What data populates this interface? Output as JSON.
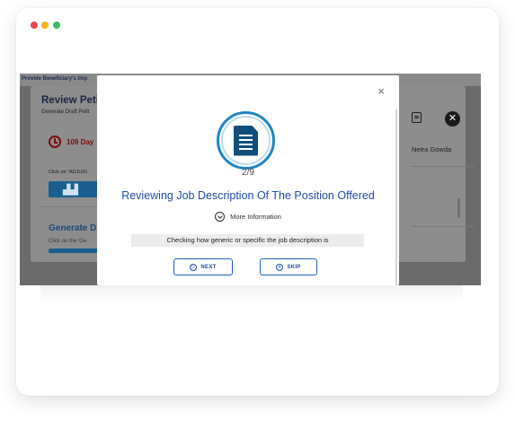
{
  "window": {
    "dots": [
      "#ef4056",
      "#f7b41e",
      "#3cbd62"
    ]
  },
  "background": {
    "top_bar": "Provide Beneficiary's Imp",
    "title": "Review Peti",
    "subtitle": "Generate Draft Petit",
    "days": "109 Day",
    "click_adjudi": "Click on \"ADJUDI",
    "generate": "Generate D",
    "click_gen": "Click on the 'Ge",
    "user_name": "Netra Gowda",
    "close_glyph": "✕",
    "chart_glyph": "▟▟"
  },
  "modal": {
    "close_glyph": "×",
    "counter": "2/9",
    "title": "Reviewing Job Description Of The Position Offered",
    "more_info": "More Information",
    "info_text": "Checking how generic or specific the job description is",
    "next_label": "NEXT",
    "skip_label": "SKIP",
    "next_glyph": "▷",
    "skip_glyph": "✕"
  },
  "colors": {
    "accent": "#1f4aa8",
    "badge_ring": "#1f86c4",
    "doc": "#0f4f79"
  }
}
